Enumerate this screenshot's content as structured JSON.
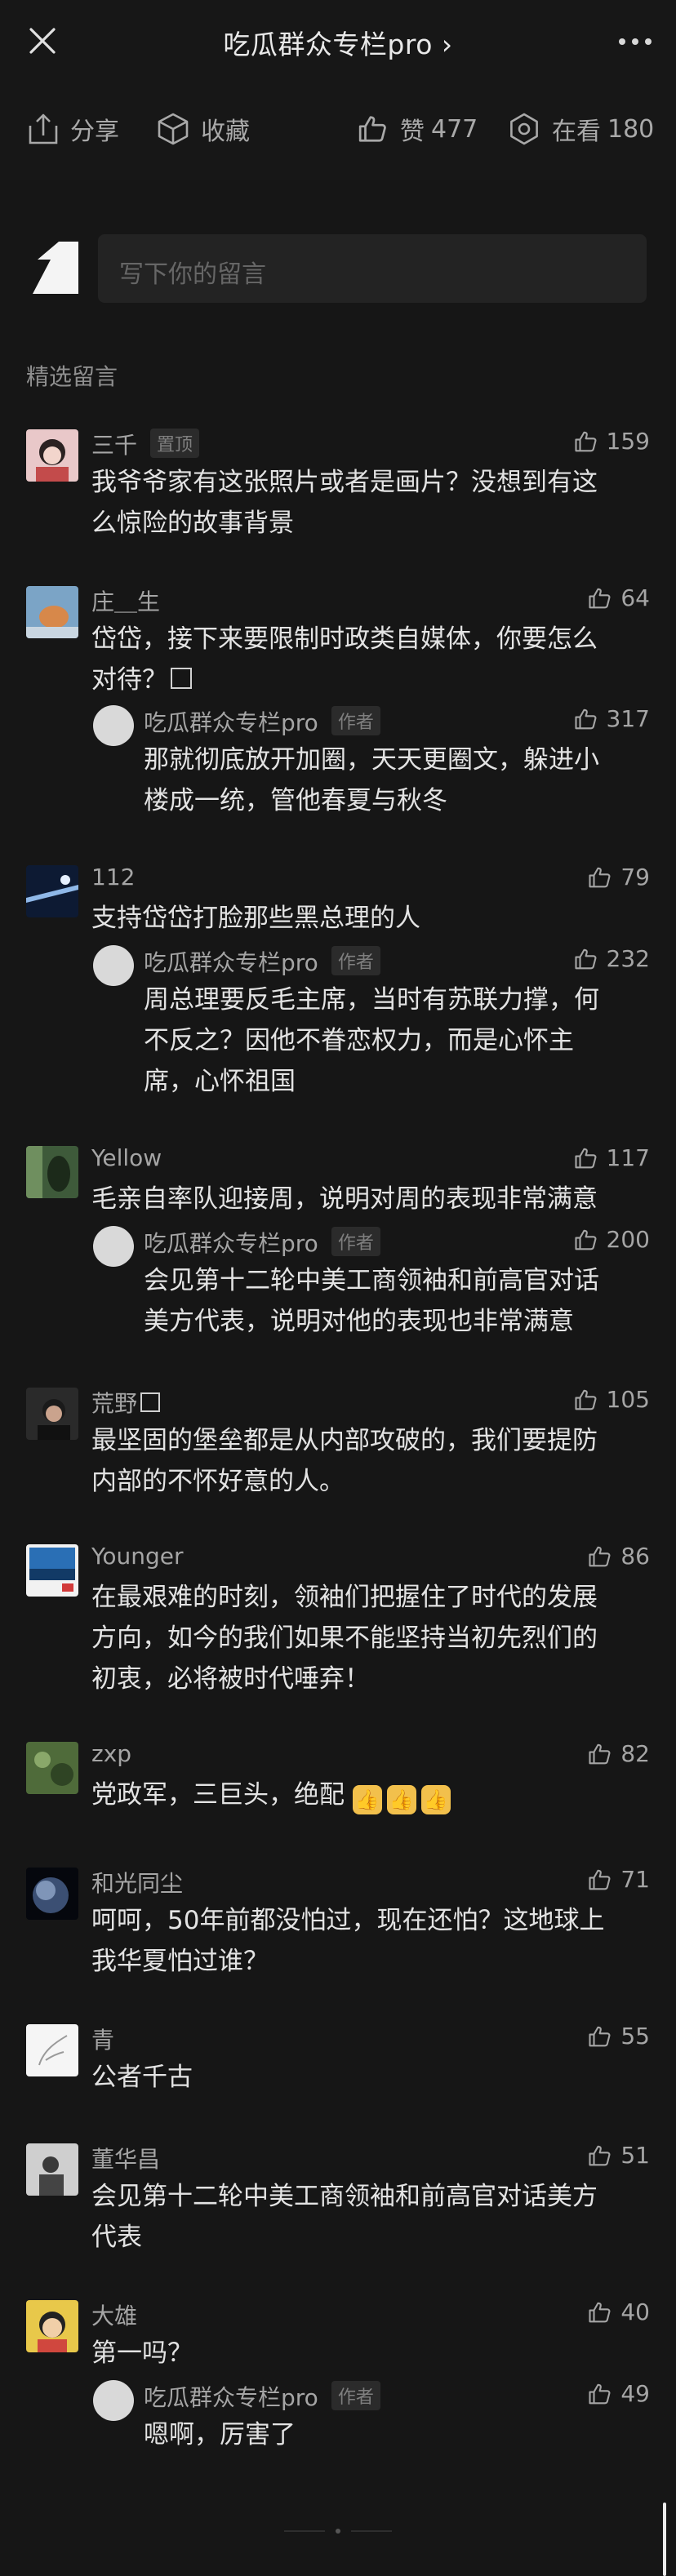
{
  "header": {
    "title": "吃瓜群众专栏pro",
    "title_chevron": "›"
  },
  "actions": {
    "share_label": "分享",
    "favorite_label": "收藏",
    "like_label": "赞",
    "like_count": "477",
    "watch_label": "在看",
    "watch_count": "180"
  },
  "compose": {
    "placeholder": "写下你的留言"
  },
  "section_title": "精选留言",
  "reply_author": "吃瓜群众专栏pro",
  "author_tag": "作者",
  "comments": [
    {
      "name": "三千",
      "tag": "置顶",
      "likes": "159",
      "lines": [
        "我爷爷家有这张照片或者是画片？没想到有这",
        "么惊险的故事背景"
      ]
    },
    {
      "name": "庄＿生",
      "likes": "64",
      "lines": [
        "岱岱，接下来要限制时政类自媒体，你要怎么",
        "对待？"
      ],
      "reply": {
        "likes": "317",
        "lines": [
          "那就彻底放开加圈，天天更圈文，躲进小",
          "楼成一统，管他春夏与秋冬"
        ]
      }
    },
    {
      "name": "112",
      "likes": "79",
      "lines": [
        "支持岱岱打脸那些黑总理的人"
      ],
      "reply": {
        "likes": "232",
        "lines": [
          "周总理要反毛主席，当时有苏联力撑，何",
          "不反之？因他不眷恋权力，而是心怀主",
          "席，心怀祖国"
        ]
      }
    },
    {
      "name": "Yellow",
      "likes": "117",
      "lines": [
        "毛亲自率队迎接周，说明对周的表现非常满意"
      ],
      "reply": {
        "likes": "200",
        "lines": [
          "会见第十二轮中美工商领袖和前高官对话",
          "美方代表，说明对他的表现也非常满意"
        ]
      }
    },
    {
      "name": "荒野",
      "likes": "105",
      "lines": [
        "最坚固的堡垒都是从内部攻破的，我们要提防",
        "内部的不怀好意的人。"
      ]
    },
    {
      "name": "Younger",
      "likes": "86",
      "lines": [
        "在最艰难的时刻，领袖们把握住了时代的发展",
        "方向，如今的我们如果不能坚持当初先烈们的",
        "初衷，必将被时代唾弃！"
      ]
    },
    {
      "name": "zxp",
      "likes": "82",
      "lines": [
        "党政军，三巨头，绝配"
      ]
    },
    {
      "name": "和光同尘",
      "likes": "71",
      "lines": [
        "呵呵，50年前都没怕过，现在还怕？这地球上",
        "我华夏怕过谁？"
      ]
    },
    {
      "name": "青",
      "likes": "55",
      "lines": [
        "公者千古"
      ]
    },
    {
      "name": "董华昌",
      "likes": "51",
      "lines": [
        "会见第十二轮中美工商领袖和前高官对话美方",
        "代表"
      ]
    },
    {
      "name": "大雄",
      "likes": "40",
      "lines": [
        "第一吗？"
      ],
      "reply": {
        "likes": "49",
        "lines": [
          "嗯啊，厉害了"
        ]
      }
    }
  ]
}
